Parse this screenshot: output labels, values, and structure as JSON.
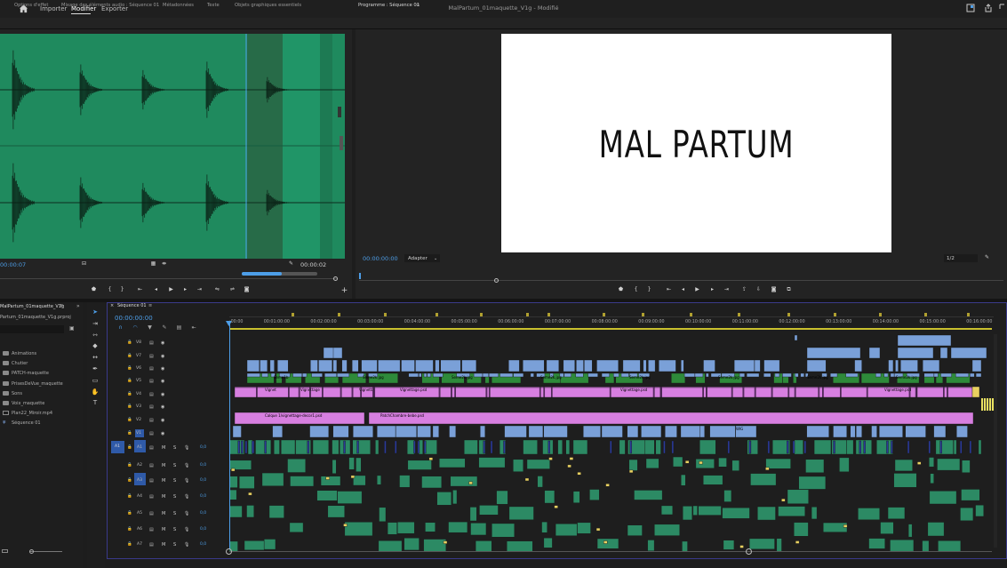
{
  "menu": {
    "import": "Importer",
    "edit": "Modifier",
    "export": "Exporter"
  },
  "doc_title": "MalPartum_01maquette_V1g - Modifié",
  "source_tabs": [
    "Options d'effet",
    "Mixage des éléments audio : Séquence 01",
    "Métadonnées",
    "Texte",
    "Objets graphiques essentiels"
  ],
  "program_tab": "Programme : Séquence 01",
  "source": {
    "timecode_left": "00:00:07",
    "timecode_right": "00:00:02"
  },
  "program": {
    "timecode": "00:00:00:00",
    "fit": "Adapter",
    "zoom": "1/2",
    "title_card": "MAL PARTUM"
  },
  "project": {
    "tab": "MalPartum_01maquette_V1g",
    "file": "Partum_01maquette_V1g.prproj",
    "items": [
      "Animations",
      "Chutier",
      "PATCH-maquette",
      "PrisesDeVue_maquette",
      "Sons",
      "Voix_maquette",
      "Plan22_Miroir.mp4",
      "Séquence 01"
    ]
  },
  "timeline": {
    "tab": "Séquence 01",
    "timecode": "00:00:00:00",
    "ruler": [
      ":00:00",
      "00:01:00:00",
      "00:02:00:00",
      "00:03:00:00",
      "00:04:00:00",
      "00:05:00:00",
      "00:06:00:00",
      "00:07:00:00",
      "00:08:00:00",
      "00:09:00:00",
      "00:10:00:00",
      "00:11:00:00",
      "00:12:00:00",
      "00:13:00:00",
      "00:14:00:00",
      "00:15:00:00",
      "00:16:00:00"
    ],
    "video_tracks": [
      "V8",
      "V7",
      "V6",
      "V5",
      "V4",
      "V3",
      "V2",
      "V1"
    ],
    "audio_tracks": [
      "A1",
      "A2",
      "A3",
      "A4",
      "A5",
      "A6",
      "A7"
    ],
    "audio_volume": "0,0",
    "source_patch_v": "V1",
    "source_patch_a": "A1",
    "clip_labels": {
      "v4_a": "Vignet",
      "v4_b": "Vignettage",
      "v4_c": "Vignetta",
      "v4_d": "Vignettage.psd",
      "v4_e": "Vignettage.psd",
      "v4_f": "Vignettage.psd",
      "v2_a": "Calque 1/vignettage-decor1.psd",
      "v2_b": "PatchChambre-bebe.psd",
      "v1_wig": "WIG",
      "v5": [
        "Seme1b",
        "Seme2k.jpg",
        "Seme2k.jpg",
        "Seme2k.jpg",
        "Seme2k.jpg",
        "Seme2k.jpg",
        "Seme2k.jpg",
        "Seme2k.jpg"
      ]
    },
    "track_btns": {
      "mute": "M",
      "solo": "S"
    }
  },
  "colors": {
    "wave_bg": "#1f8a5e",
    "audio_clip": "#2c8a64",
    "video_clip": "#7aa0d8",
    "graphic_clip": "#d77fe0",
    "accent": "#4d9ee8"
  }
}
